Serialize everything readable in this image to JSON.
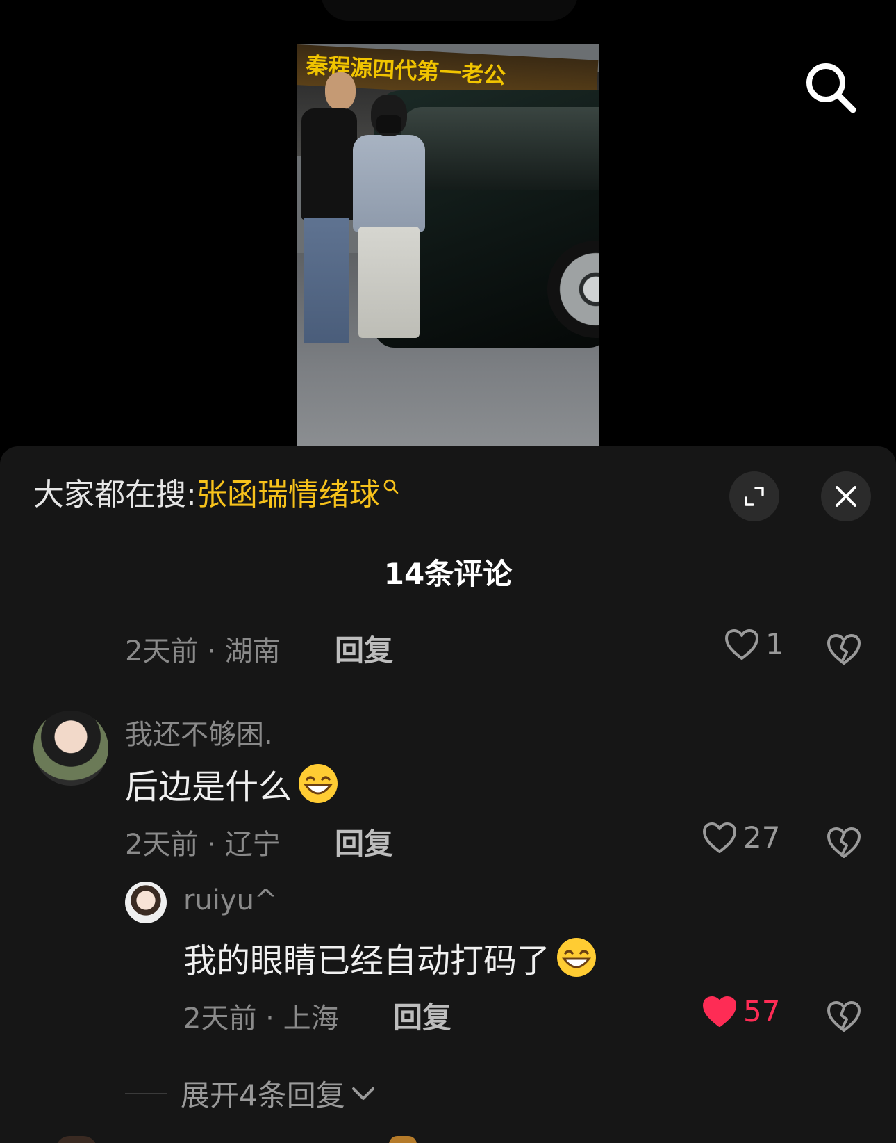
{
  "video": {
    "banner_text": "秦程源四代第一老公"
  },
  "hot_search": {
    "prefix": "大家都在搜:",
    "term": "张函瑞情绪球"
  },
  "comments_title": "14条评论",
  "comments": [
    {
      "time": "2天前",
      "location": "湖南",
      "reply_label": "回复",
      "likes": "1",
      "liked": false
    },
    {
      "username": "我还不够困.",
      "text": "后边是什么",
      "time": "2天前",
      "location": "辽宁",
      "reply_label": "回复",
      "likes": "27",
      "liked": false,
      "replies": [
        {
          "username": "ruiyu^",
          "text": "我的眼睛已经自动打码了",
          "time": "2天前",
          "location": "上海",
          "reply_label": "回复",
          "likes": "57",
          "liked": true
        }
      ],
      "expand_label": "展开4条回复"
    }
  ],
  "colors": {
    "background": "#000000",
    "sheet": "#161616",
    "hot_term": "#f7c21b",
    "liked": "#fe2c55",
    "muted": "#8a8a8a"
  },
  "icons": {
    "search": "search-icon",
    "expand": "expand-icon",
    "close": "close-icon",
    "like": "heart-icon",
    "dislike": "broken-heart-icon",
    "emoji": "grinning-emoji-icon"
  }
}
